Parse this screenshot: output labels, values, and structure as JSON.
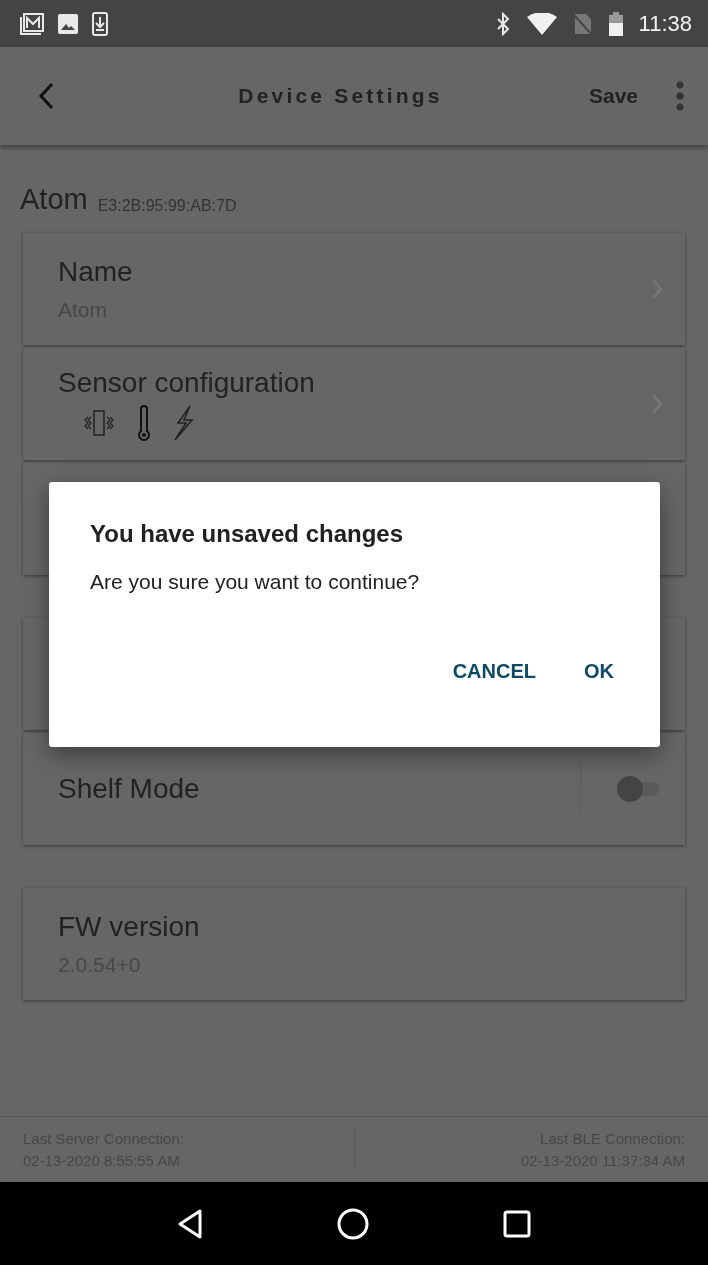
{
  "status_bar": {
    "time": "11:38"
  },
  "toolbar": {
    "title": "Device Settings",
    "action": "Save"
  },
  "device": {
    "name": "Atom",
    "address": "E3:2B:95:99:AB:7D"
  },
  "sections": [
    {
      "items": [
        {
          "kind": "value",
          "label": "Name",
          "value": "Atom"
        },
        {
          "kind": "sensors",
          "label": "Sensor configuration"
        },
        {
          "kind": "covered"
        }
      ]
    },
    {
      "items": [
        {
          "kind": "covered"
        },
        {
          "kind": "switch",
          "label": "Shelf Mode",
          "on": false
        }
      ]
    },
    {
      "items": [
        {
          "kind": "info",
          "label": "FW version",
          "value": "2.0.54+0"
        }
      ]
    }
  ],
  "footer": [
    {
      "label": "Last Server Connection:",
      "value": "02-13-2020 8:55:55 AM"
    },
    {
      "label": "Last BLE Connection:",
      "value": "02-13-2020 11:37:34 AM"
    }
  ],
  "dialog": {
    "title": "You have unsaved changes",
    "message": "Are you sure you want to continue?",
    "buttons": [
      "CANCEL",
      "OK"
    ]
  }
}
